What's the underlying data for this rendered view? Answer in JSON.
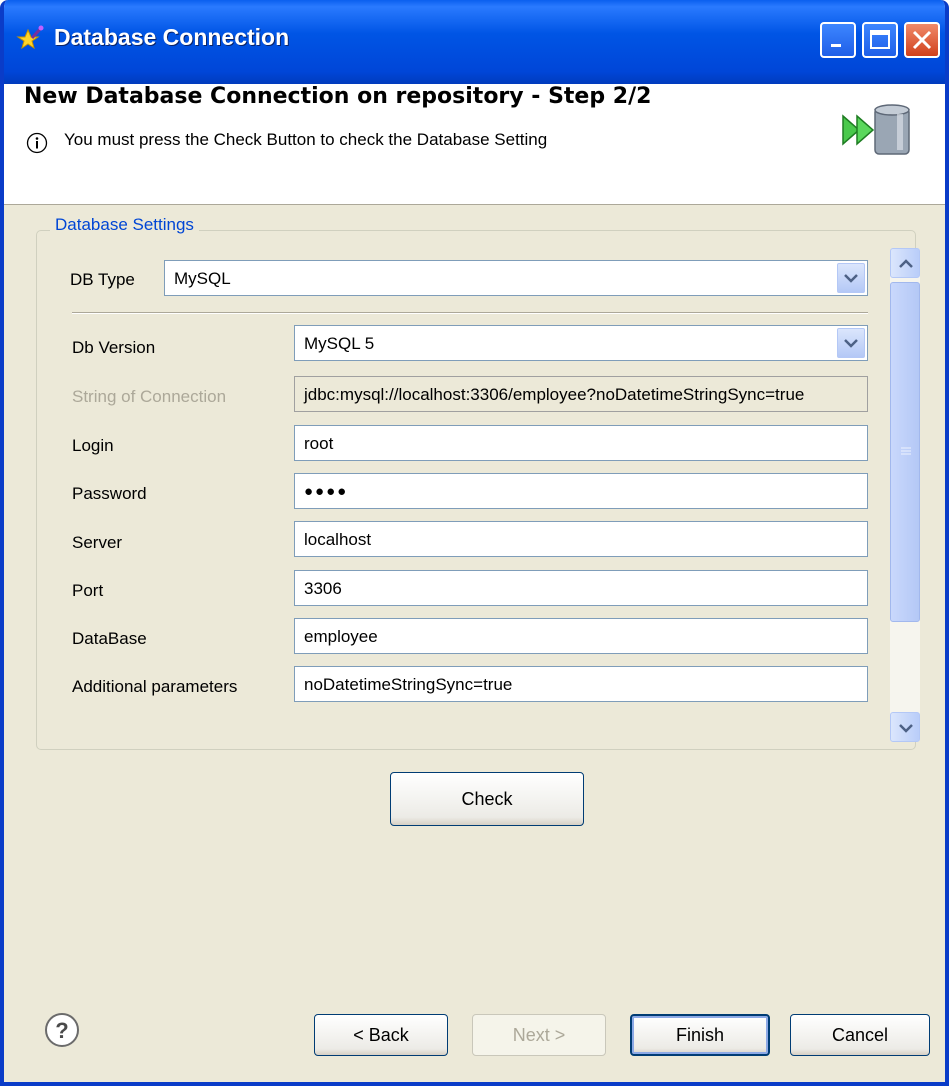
{
  "window": {
    "title": "Database Connection",
    "icon": "star-wand-icon",
    "controls": [
      "minimize-icon",
      "maximize-icon",
      "close-icon"
    ]
  },
  "header": {
    "title": "New Database Connection on repository - Step 2/2",
    "message": "You must press the Check Button to check the Database Setting",
    "image": "database-connect-icon"
  },
  "group": {
    "legend": "Database Settings",
    "db_type": {
      "label": "DB Type",
      "value": "MySQL"
    },
    "db_version": {
      "label": "Db Version",
      "value": "MySQL 5"
    },
    "connection_string": {
      "label": "String of Connection",
      "value": "jdbc:mysql://localhost:3306/employee?noDatetimeStringSync=true"
    },
    "login": {
      "label": "Login",
      "value": "root"
    },
    "password": {
      "label": "Password",
      "value": "●●●●"
    },
    "server": {
      "label": "Server",
      "value": "localhost"
    },
    "port": {
      "label": "Port",
      "value": "3306"
    },
    "database": {
      "label": "DataBase",
      "value": "employee"
    },
    "additional_params": {
      "label": "Additional parameters",
      "value": "noDatetimeStringSync=true"
    }
  },
  "buttons": {
    "check": "Check",
    "back": "< Back",
    "next": "Next >",
    "finish": "Finish",
    "cancel": "Cancel"
  },
  "colors": {
    "titlebar": "#0055e5",
    "legend": "#0046d5",
    "dialog_bg": "#ece9d8",
    "close_button": "#d1401c"
  }
}
